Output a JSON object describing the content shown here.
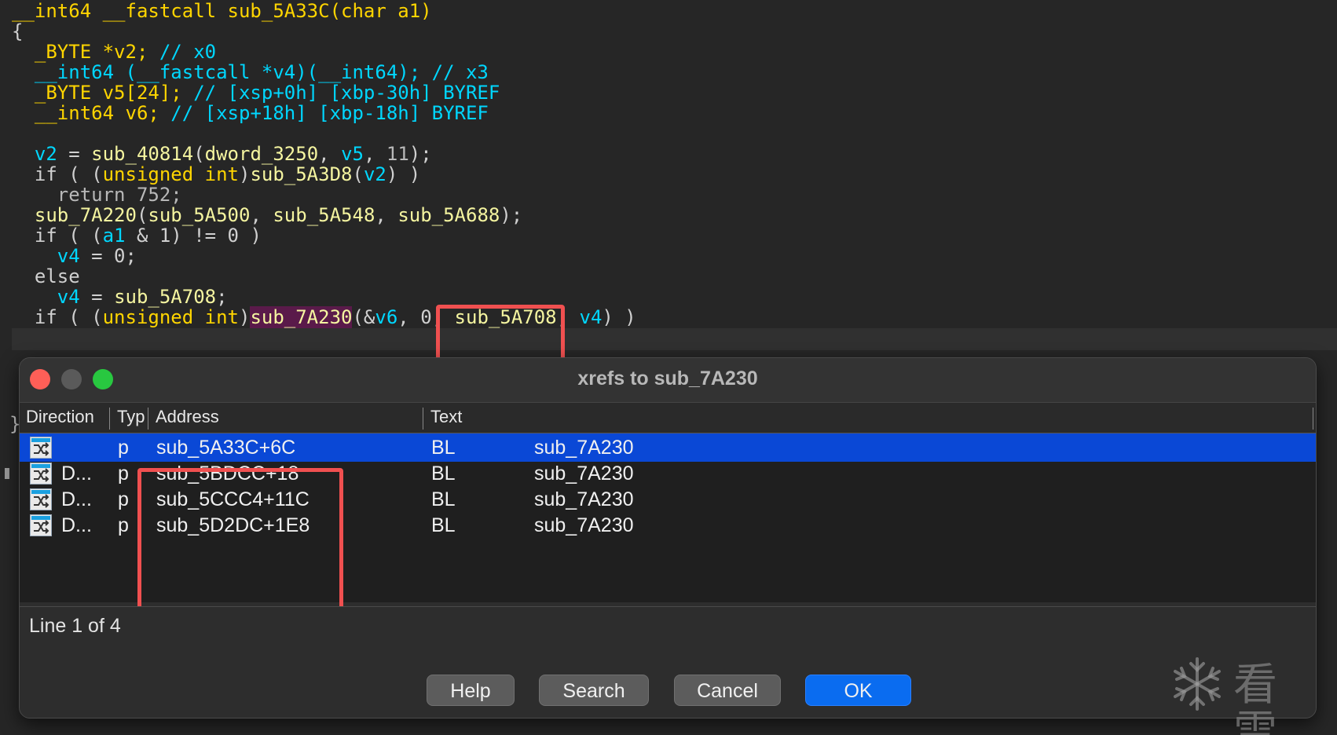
{
  "code": {
    "lines": [
      [
        {
          "t": "__int64 __fastcall sub_5A33C(char a1)",
          "c": "t-kw"
        }
      ],
      [
        {
          "t": "{",
          "c": "t-pl"
        }
      ],
      [
        {
          "t": "  _BYTE *v2; ",
          "c": "t-kw"
        },
        {
          "t": "// x0",
          "c": "t-cmt"
        }
      ],
      [
        {
          "t": "  __int64 (__fastcall *v4)(__int64); ",
          "c": "t-cmt"
        },
        {
          "t": "// x3",
          "c": "t-cmt"
        }
      ],
      [
        {
          "t": "  _BYTE v5[24]; ",
          "c": "t-kw"
        },
        {
          "t": "// [xsp+0h] [xbp-30h] BYREF",
          "c": "t-cmt"
        }
      ],
      [
        {
          "t": "  __int64 v6; ",
          "c": "t-kw"
        },
        {
          "t": "// [xsp+18h] [xbp-18h] BYREF",
          "c": "t-cmt"
        }
      ],
      [
        {
          "t": "",
          "c": "t-pl"
        }
      ],
      [
        {
          "t": "  v2",
          "c": "t-var"
        },
        {
          "t": " = ",
          "c": "t-pl"
        },
        {
          "t": "sub_40814",
          "c": "t-fn"
        },
        {
          "t": "(",
          "c": "t-pl"
        },
        {
          "t": "dword_3250",
          "c": "t-fn"
        },
        {
          "t": ", ",
          "c": "t-pl"
        },
        {
          "t": "v5",
          "c": "t-var"
        },
        {
          "t": ", ",
          "c": "t-pl"
        },
        {
          "t": "11",
          "c": "t-num"
        },
        {
          "t": ");",
          "c": "t-pl"
        }
      ],
      [
        {
          "t": "  if ( (",
          "c": "t-pl"
        },
        {
          "t": "unsigned int",
          "c": "t-type"
        },
        {
          "t": ")",
          "c": "t-pl"
        },
        {
          "t": "sub_5A3D8",
          "c": "t-fn"
        },
        {
          "t": "(",
          "c": "t-pl"
        },
        {
          "t": "v2",
          "c": "t-var"
        },
        {
          "t": ") )",
          "c": "t-pl"
        }
      ],
      [
        {
          "t": "    return 752;",
          "c": "t-num"
        }
      ],
      [
        {
          "t": "  sub_7A220",
          "c": "t-fn"
        },
        {
          "t": "(",
          "c": "t-pl"
        },
        {
          "t": "sub_5A500",
          "c": "t-fn"
        },
        {
          "t": ", ",
          "c": "t-pl"
        },
        {
          "t": "sub_5A548",
          "c": "t-fn"
        },
        {
          "t": ", ",
          "c": "t-pl"
        },
        {
          "t": "sub_5A688",
          "c": "t-fn"
        },
        {
          "t": ");",
          "c": "t-pl"
        }
      ],
      [
        {
          "t": "  if ( (",
          "c": "t-pl"
        },
        {
          "t": "a1",
          "c": "t-var"
        },
        {
          "t": " & 1) != 0 )",
          "c": "t-pl"
        }
      ],
      [
        {
          "t": "    v4",
          "c": "t-var"
        },
        {
          "t": " = 0;",
          "c": "t-pl"
        }
      ],
      [
        {
          "t": "  else",
          "c": "t-pl"
        }
      ],
      [
        {
          "t": "    v4",
          "c": "t-var"
        },
        {
          "t": " = ",
          "c": "t-pl"
        },
        {
          "t": "sub_5A708",
          "c": "t-fn"
        },
        {
          "t": ";",
          "c": "t-pl"
        }
      ],
      [
        {
          "t": "  if ( (",
          "c": "t-pl"
        },
        {
          "t": "unsigned int",
          "c": "t-type"
        },
        {
          "t": ")",
          "c": "t-pl"
        },
        {
          "t": "sub_7A230",
          "c": "t-mag"
        },
        {
          "t": "(&",
          "c": "t-pl"
        },
        {
          "t": "v6",
          "c": "t-var"
        },
        {
          "t": ", 0, ",
          "c": "t-pl"
        },
        {
          "t": "sub_5A708",
          "c": "t-fn"
        },
        {
          "t": ", ",
          "c": "t-pl"
        },
        {
          "t": "v4",
          "c": "t-var"
        },
        {
          "t": ") )",
          "c": "t-pl"
        }
      ]
    ],
    "closing_brace": "}"
  },
  "dialog": {
    "title": "xrefs to sub_7A230",
    "columns": [
      "Direction",
      "Typ",
      "Address",
      "Text"
    ],
    "rows": [
      {
        "direction": "",
        "type": "p",
        "address": "sub_5A33C+6C",
        "mnemonic": "BL",
        "operand": "sub_7A230",
        "selected": true
      },
      {
        "direction": "D...",
        "type": "p",
        "address": "sub_5BDCC+18",
        "mnemonic": "BL",
        "operand": "sub_7A230",
        "selected": false
      },
      {
        "direction": "D...",
        "type": "p",
        "address": "sub_5CCC4+11C",
        "mnemonic": "BL",
        "operand": "sub_7A230",
        "selected": false
      },
      {
        "direction": "D...",
        "type": "p",
        "address": "sub_5D2DC+1E8",
        "mnemonic": "BL",
        "operand": "sub_7A230",
        "selected": false
      }
    ],
    "status": "Line 1 of 4",
    "buttons": {
      "help": "Help",
      "search": "Search",
      "cancel": "Cancel",
      "ok": "OK"
    }
  },
  "watermark": {
    "text": "看雪",
    "icon": "snowflake-icon"
  },
  "colors": {
    "selection": "#0a48d6",
    "annotation_box": "#f05050",
    "ok_button": "#0a6cf0"
  }
}
